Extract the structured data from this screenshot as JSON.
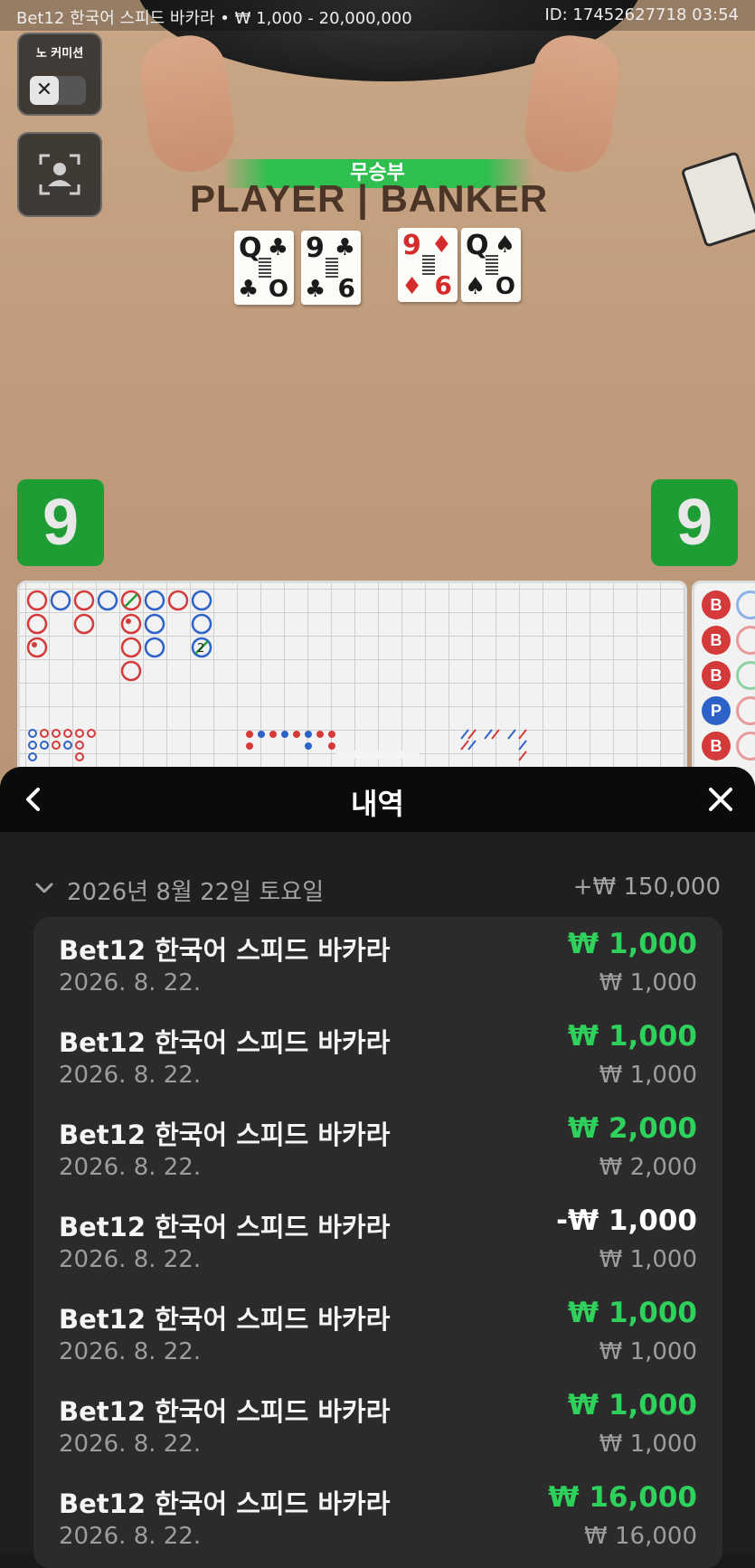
{
  "top_bar": {
    "title": "Bet12 한국어 스피드 바카라 • ₩ 1,000 - 20,000,000",
    "id_time": "ID: 17452627718 03:54"
  },
  "controls": {
    "commission_label": "노 커미션",
    "commission_toggle_icon": "close-icon",
    "camera_icon": "camera-focus-icon"
  },
  "table": {
    "result_banner": "무승부",
    "layout_text": "PLAYER | BANKER",
    "player_cards": [
      {
        "rank": "Q",
        "suit": "♣",
        "color": "#1a1a1a"
      },
      {
        "rank": "9",
        "suit": "♣",
        "color": "#1a1a1a",
        "low": "6"
      }
    ],
    "banker_cards": [
      {
        "rank": "9",
        "suit": "♦",
        "color": "#d62b2b",
        "low": "6"
      },
      {
        "rank": "Q",
        "suit": "♠",
        "color": "#1a1a1a"
      }
    ],
    "player_score": "9",
    "banker_score": "9"
  },
  "bead_road": [
    "B",
    "B",
    "B",
    "P",
    "B"
  ],
  "colors": {
    "banker": "#d43a3a",
    "player": "#2d63c9",
    "tie": "#1e9d35",
    "win_text": "#2ed15c"
  },
  "panel": {
    "title": "내역",
    "back_icon": "chevron-left-icon",
    "close_icon": "close-icon",
    "date_group": {
      "label": "2026년 8월 22일 토요일",
      "total": "+₩ 150,000",
      "chevron_icon": "chevron-down-icon"
    },
    "rows": [
      {
        "name": "Bet12 한국어 스피드 바카라",
        "date": "2026. 8. 22.",
        "result": "₩ 1,000",
        "bet": "₩ 1,000",
        "win": true
      },
      {
        "name": "Bet12 한국어 스피드 바카라",
        "date": "2026. 8. 22.",
        "result": "₩ 1,000",
        "bet": "₩ 1,000",
        "win": true
      },
      {
        "name": "Bet12 한국어 스피드 바카라",
        "date": "2026. 8. 22.",
        "result": "₩ 2,000",
        "bet": "₩ 2,000",
        "win": true
      },
      {
        "name": "Bet12 한국어 스피드 바카라",
        "date": "2026. 8. 22.",
        "result": "-₩ 1,000",
        "bet": "₩ 1,000",
        "win": false
      },
      {
        "name": "Bet12 한국어 스피드 바카라",
        "date": "2026. 8. 22.",
        "result": "₩ 1,000",
        "bet": "₩ 1,000",
        "win": true
      },
      {
        "name": "Bet12 한국어 스피드 바카라",
        "date": "2026. 8. 22.",
        "result": "₩ 1,000",
        "bet": "₩ 1,000",
        "win": true
      },
      {
        "name": "Bet12 한국어 스피드 바카라",
        "date": "2026. 8. 22.",
        "result": "₩ 16,000",
        "bet": "₩ 16,000",
        "win": true
      }
    ]
  }
}
